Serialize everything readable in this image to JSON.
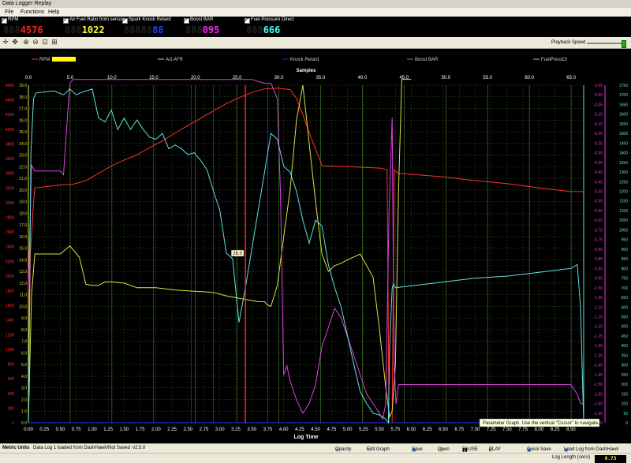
{
  "window": {
    "title": "Data Logger Replay"
  },
  "menu": [
    "File",
    "Functions",
    "Help"
  ],
  "channels": [
    {
      "label": "RPM",
      "value": "4576",
      "ghost": "888",
      "color": "#ff2020"
    },
    {
      "label": "Air Fuel Ratio from sensor",
      "value": "1022",
      "ghost": "888",
      "color": "#ffff20"
    },
    {
      "label": "Spark Knock Retard",
      "value": "88",
      "ghost": "88888",
      "color": "#2040ff"
    },
    {
      "label": "Boost BAR",
      "value": "095",
      "ghost": "888",
      "color": "#ff20ff"
    },
    {
      "label": "Fuel Pressure Direct",
      "value": "666",
      "ghost": "888",
      "color": "#40ffff"
    }
  ],
  "toolbar": {
    "playback_speed_label": "Playback Speed",
    "playback_speed_level": 0.95
  },
  "chart_data": {
    "type": "line",
    "top_axis": {
      "label": "Samples",
      "ticks": [
        "0.0",
        "5.0",
        "10.0",
        "15.0",
        "20.0",
        "25.0",
        "30.0",
        "35.0",
        "40.0",
        "45.0",
        "50.0",
        "55.0",
        "60.0",
        "65.0"
      ],
      "range": [
        0,
        66.5
      ]
    },
    "xlabel": "Log Time",
    "xlim": [
      0,
      8.7
    ],
    "x_ticks": [
      "0.00",
      "0.25",
      "0.50",
      "0.75",
      "1.00",
      "1.25",
      "1.50",
      "1.75",
      "2.00",
      "2.25",
      "2.50",
      "2.75",
      "3.00",
      "3.25",
      "3.50",
      "3.75",
      "4.00",
      "4.25",
      "4.50",
      "4.75",
      "5.00",
      "5.25",
      "5.50",
      "5.75",
      "6.00",
      "6.25",
      "6.50",
      "6.75",
      "7.00",
      "7.25",
      "7.50",
      "7.75",
      "8.00",
      "8.25",
      "8.50"
    ],
    "cursor_time": 3.4,
    "cursor_label": "26.0",
    "tooltip": "Parameter Graph.  Use the vertical \"Cursor\" to navigate.",
    "series": [
      {
        "name": "RPM",
        "color": "#ff3030",
        "ylim": [
          0,
          4600
        ],
        "x": [
          0.0,
          0.03,
          0.06,
          0.08,
          0.1,
          0.3,
          0.5,
          0.7,
          0.9,
          1.1,
          1.3,
          1.5,
          1.7,
          1.9,
          2.1,
          2.3,
          2.5,
          2.7,
          2.9,
          3.1,
          3.3,
          3.5,
          3.7,
          3.9,
          4.1,
          4.2,
          4.3,
          4.4,
          4.55,
          4.6,
          5.0,
          5.5,
          5.62,
          5.65,
          5.7,
          5.73,
          5.76,
          5.8,
          6.5,
          7.0,
          7.5,
          8.0,
          8.5,
          8.7
        ],
        "y": [
          0,
          2300,
          2700,
          3000,
          3200,
          3220,
          3240,
          3250,
          3300,
          3400,
          3500,
          3580,
          3650,
          3750,
          3840,
          3950,
          4050,
          4150,
          4250,
          4350,
          4430,
          4500,
          4550,
          4560,
          4540,
          4420,
          4200,
          3950,
          3620,
          3500,
          3490,
          3470,
          3450,
          0,
          0,
          3450,
          3420,
          3400,
          3350,
          3300,
          3260,
          3200,
          3150,
          3150
        ]
      },
      {
        "name": "Act AFR",
        "color": "#e0e040",
        "ylim": [
          0,
          29
        ],
        "x": [
          0.0,
          0.05,
          0.1,
          0.5,
          0.65,
          0.8,
          0.9,
          1.0,
          1.1,
          1.2,
          1.3,
          1.5,
          1.7,
          2.0,
          2.3,
          2.6,
          2.9,
          3.1,
          3.3,
          3.4,
          3.6,
          3.7,
          3.75,
          3.8,
          3.9,
          4.0,
          4.1,
          4.2,
          4.3,
          4.4,
          4.5,
          4.6,
          4.7,
          4.8,
          4.9,
          5.0,
          5.2,
          5.4,
          5.5,
          5.6,
          5.66,
          5.7,
          5.75,
          5.8,
          5.85,
          6.0
        ],
        "y": [
          0,
          11,
          14.5,
          14.5,
          15.2,
          14.2,
          11.9,
          11.8,
          11.8,
          12.1,
          12.1,
          12.0,
          11.6,
          11.6,
          11.4,
          11.3,
          11.2,
          10.9,
          10.7,
          10.6,
          10.4,
          10.4,
          10.1,
          10.0,
          11.8,
          16.0,
          20.0,
          26.0,
          29.0,
          24.0,
          19.0,
          14.5,
          13.0,
          13.5,
          13.7,
          14.0,
          14.5,
          12.5,
          8.0,
          3.0,
          0.5,
          1.0,
          5.0,
          20.0,
          29.5,
          29.5
        ]
      },
      {
        "name": "Knock Retard",
        "color": "#2030ff",
        "ylim": [
          0,
          1
        ],
        "x": [
          0,
          8.7
        ],
        "y": [
          0,
          0
        ]
      },
      {
        "name": "Boost BAR",
        "color": "#e040e0",
        "ylim": [
          -1.7,
          0.07
        ],
        "x": [
          0.0,
          0.05,
          0.1,
          0.5,
          0.55,
          0.6,
          0.65,
          0.7,
          1.0,
          2.0,
          3.0,
          3.5,
          3.6,
          3.7,
          3.8,
          3.9,
          3.95,
          4.0,
          4.05,
          4.1,
          4.2,
          4.3,
          4.4,
          4.5,
          4.6,
          4.7,
          4.8,
          4.9,
          5.0,
          5.1,
          5.2,
          5.3,
          5.4,
          5.5,
          5.55,
          5.6,
          5.65,
          5.7,
          5.73,
          5.76,
          5.8,
          6.0,
          7.0,
          8.0,
          8.5,
          8.6,
          8.65,
          8.7
        ],
        "y": [
          -1.0,
          -0.35,
          -0.38,
          -0.38,
          -0.4,
          -0.15,
          0.08,
          0.1,
          0.1,
          0.1,
          0.1,
          0.1,
          0.09,
          0.08,
          0.08,
          0.0,
          -0.5,
          -1.45,
          -1.4,
          -1.48,
          -1.58,
          -1.65,
          -1.6,
          -1.5,
          -1.3,
          -1.2,
          -1.1,
          -1.15,
          -1.25,
          -1.35,
          -1.45,
          -1.55,
          -1.6,
          -1.65,
          -1.68,
          -1.6,
          -0.6,
          -0.1,
          -1.4,
          -1.6,
          -1.5,
          -1.5,
          -1.5,
          -1.5,
          -1.5,
          -1.55,
          -1.6,
          -1.6
        ]
      },
      {
        "name": "FuelPressDI",
        "color": "#60e0e0",
        "ylim": [
          0,
          1750
        ],
        "x": [
          0.0,
          0.04,
          0.08,
          0.12,
          0.4,
          0.55,
          0.65,
          0.75,
          0.85,
          1.0,
          1.1,
          1.2,
          1.3,
          1.4,
          1.5,
          1.6,
          1.7,
          1.8,
          1.9,
          2.0,
          2.1,
          2.2,
          2.3,
          2.4,
          2.5,
          2.6,
          2.7,
          2.8,
          2.9,
          3.0,
          3.1,
          3.2,
          3.3,
          3.4,
          3.5,
          3.6,
          3.7,
          3.8,
          3.9,
          4.0,
          4.1,
          4.2,
          4.3,
          4.4,
          4.5,
          4.6,
          4.7,
          4.8,
          4.9,
          5.0,
          5.1,
          5.2,
          5.3,
          5.4,
          5.5,
          5.6,
          5.64,
          5.66,
          5.7,
          5.72,
          5.75,
          6.0,
          6.5,
          7.0,
          7.5,
          8.0,
          8.5,
          8.6,
          8.65,
          8.7
        ],
        "y": [
          0,
          1400,
          1680,
          1710,
          1720,
          1700,
          1730,
          1700,
          1715,
          1730,
          1580,
          1560,
          1620,
          1520,
          1580,
          1520,
          1570,
          1520,
          1480,
          1470,
          1500,
          1420,
          1440,
          1420,
          1390,
          1400,
          1360,
          1310,
          1200,
          1100,
          880,
          850,
          520,
          700,
          900,
          1100,
          1300,
          1500,
          1470,
          1330,
          1300,
          1200,
          1050,
          930,
          1050,
          1020,
          820,
          700,
          600,
          450,
          300,
          160,
          100,
          50,
          40,
          20,
          0,
          400,
          700,
          720,
          700,
          710,
          730,
          750,
          760,
          780,
          800,
          820,
          600,
          0
        ],
        "yshift": 0
      }
    ]
  },
  "axes_left": {
    "rpm_ticks": [
      "0",
      "200",
      "400",
      "600",
      "800",
      "1000",
      "1200",
      "1400",
      "1600",
      "1800",
      "2000",
      "2200",
      "2400",
      "2600",
      "2800",
      "3000",
      "3200",
      "3400",
      "3600",
      "3800",
      "4000",
      "4200",
      "4400",
      "4600"
    ],
    "afr_ticks": [
      "0.0",
      "1.0",
      "2.0",
      "3.0",
      "4.0",
      "5.0",
      "6.0",
      "7.0",
      "8.0",
      "9.0",
      "10.0",
      "11.0",
      "12.0",
      "13.0",
      "14.0",
      "15.0",
      "16.0",
      "17.0",
      "18.0",
      "19.0",
      "20.0",
      "21.0",
      "22.0",
      "23.0",
      "24.0",
      "25.0",
      "26.0",
      "27.0",
      "28.0",
      "29.0"
    ]
  },
  "axes_right": {
    "boost_ticks": [
      "0.05",
      "0.00",
      "-0.05",
      "-0.10",
      "-0.15",
      "-0.20",
      "-0.25",
      "-0.30",
      "-0.35",
      "-0.40",
      "-0.45",
      "-0.50",
      "-0.55",
      "-0.60",
      "-0.65",
      "-0.70",
      "-0.75",
      "-0.80",
      "-0.85",
      "-0.90",
      "-0.95",
      "-1.00",
      "-1.05",
      "-1.10",
      "-1.15",
      "-1.20",
      "-1.25",
      "-1.30",
      "-1.35",
      "-1.40",
      "-1.45",
      "-1.50",
      "-1.55",
      "-1.60",
      "-1.65",
      "-1.70"
    ],
    "fp_ticks": [
      "0",
      "50",
      "100",
      "150",
      "200",
      "250",
      "300",
      "350",
      "400",
      "450",
      "500",
      "550",
      "600",
      "650",
      "700",
      "750",
      "800",
      "850",
      "900",
      "950",
      "1000",
      "1050",
      "1100",
      "1150",
      "1200",
      "1250",
      "1300",
      "1350",
      "1400",
      "1450",
      "1500",
      "1550",
      "1600",
      "1650",
      "1700",
      "1750"
    ]
  },
  "statusbar": {
    "units": "Metric Units",
    "log_status": "Data Log 1 loaded from DashHawk/Not Saved",
    "version": "v2.5.0",
    "buttons": [
      "Opacity",
      "Edit Graph",
      "Save",
      "Open",
      "PAUSE",
      "PLAY",
      "Quick Save",
      "Load Log from DashHawk"
    ]
  },
  "bottom": {
    "log_length_label": "Log Length (secs)",
    "log_length_value": "8.73"
  }
}
